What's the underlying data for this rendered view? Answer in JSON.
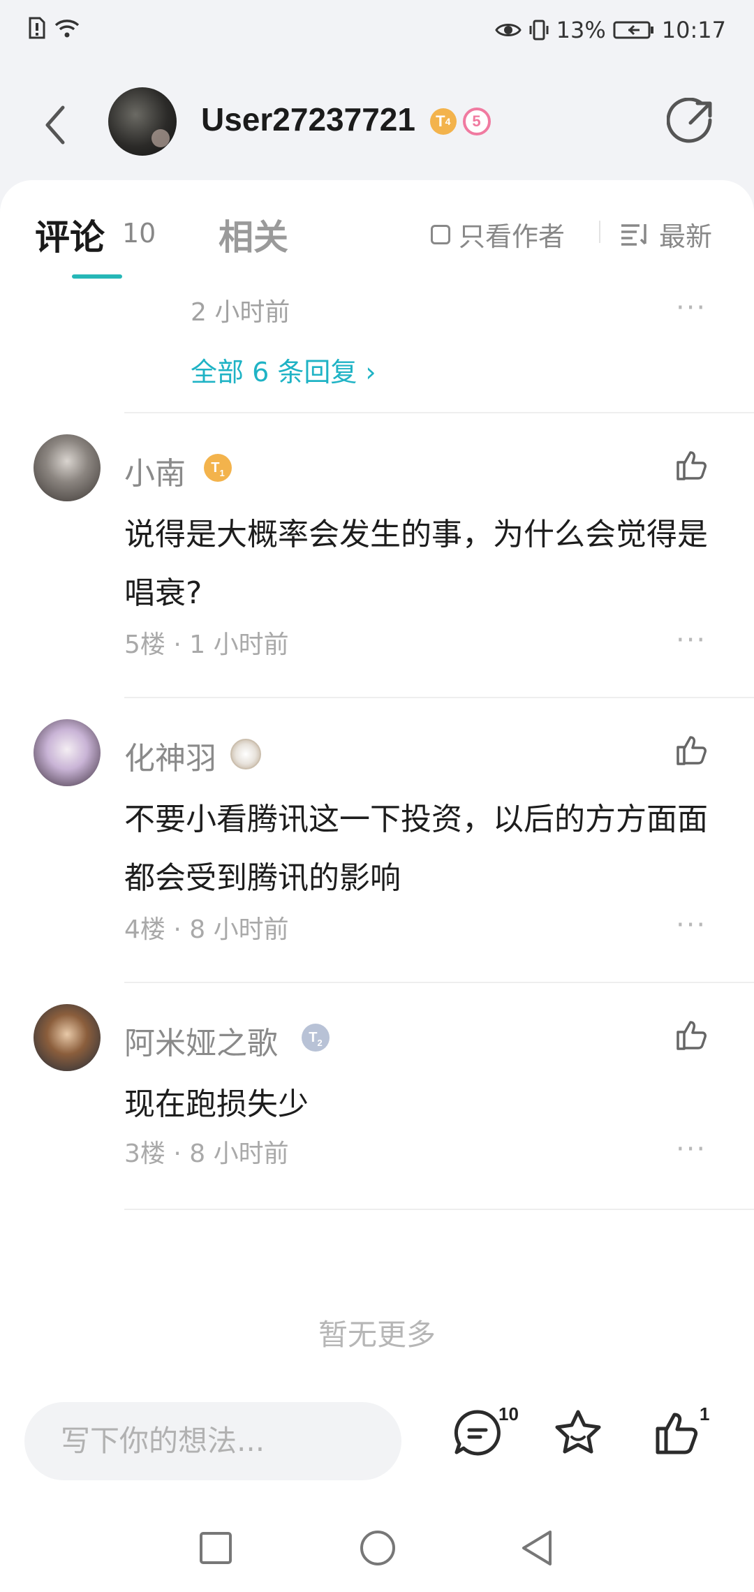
{
  "status_bar": {
    "battery": "13%",
    "time": "10:17"
  },
  "header": {
    "username": "User27237721",
    "badge_level": "T",
    "badge_level_sub": "4",
    "badge_count": "5"
  },
  "tabs": {
    "comments_label": "评论",
    "comments_count": "10",
    "related_label": "相关",
    "only_author_label": "只看作者",
    "sort_label": "最新"
  },
  "prev_comment": {
    "time": "2 小时前",
    "all_replies": "全部 6 条回复 ›"
  },
  "comments": [
    {
      "name": "小南",
      "badge_level": "T",
      "badge_sub": "1",
      "text": "说得是大概率会发生的事，为什么会觉得是唱衰?",
      "meta": "5楼 · 1 小时前"
    },
    {
      "name": "化神羽",
      "text": "不要小看腾讯这一下投资，以后的方方面面都会受到腾讯的影响",
      "meta": "4楼 · 8 小时前"
    },
    {
      "name": "阿米娅之歌",
      "badge_level": "T",
      "badge_sub": "2",
      "text": "现在跑损失少",
      "meta": "3楼 · 8 小时前"
    }
  ],
  "more_icon": "···",
  "footer_text": "暂无更多",
  "bottom_bar": {
    "input_placeholder": "写下你的想法...",
    "comment_count": "10",
    "like_count": "1"
  },
  "colors": {
    "accent": "#26b7b7",
    "link": "#1fb3c5",
    "badge_orange": "#f3b34c",
    "badge_pink": "#f07aa0",
    "badge_silver": "#b8c2d6"
  },
  "icons": [
    "back-icon",
    "share-icon",
    "checkbox-icon",
    "sort-icon",
    "more-icon",
    "thumbs-up-icon",
    "chat-icon",
    "star-icon",
    "square-nav-icon",
    "circle-nav-icon",
    "triangle-nav-icon",
    "wifi-icon",
    "sim-alert-icon",
    "eye-icon",
    "vibrate-icon",
    "battery-icon"
  ]
}
